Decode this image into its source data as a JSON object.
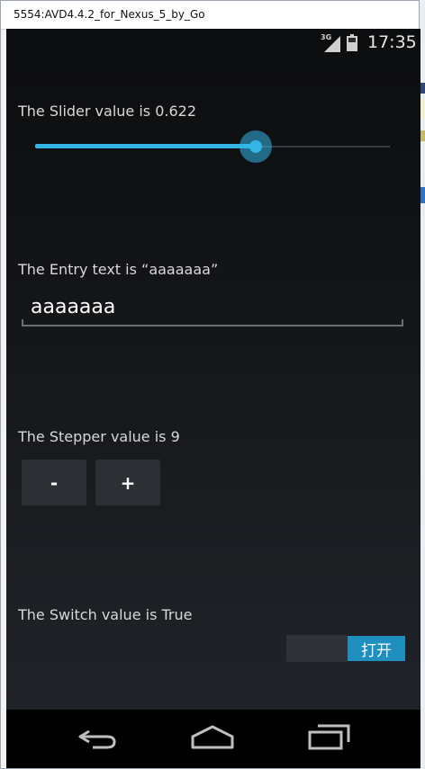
{
  "window": {
    "title": "5554:AVD4.4.2_for_Nexus_5_by_Go"
  },
  "status_bar": {
    "network": "3G",
    "time": "17:35"
  },
  "slider": {
    "label": "The Slider value is 0.622",
    "value": 0.622,
    "accent_color": "#33b5e5"
  },
  "entry": {
    "label": "The Entry text is “aaaaaaa”",
    "value": "aaaaaaa"
  },
  "stepper": {
    "label": "The Stepper value is 9",
    "minus_label": "-",
    "plus_label": "+"
  },
  "switch": {
    "label": "The Switch value is True",
    "on_text": "打开",
    "on_color": "#1f8fc0"
  },
  "nav_bar": {
    "icons": [
      "back-icon",
      "home-icon",
      "recent-apps-icon"
    ]
  }
}
